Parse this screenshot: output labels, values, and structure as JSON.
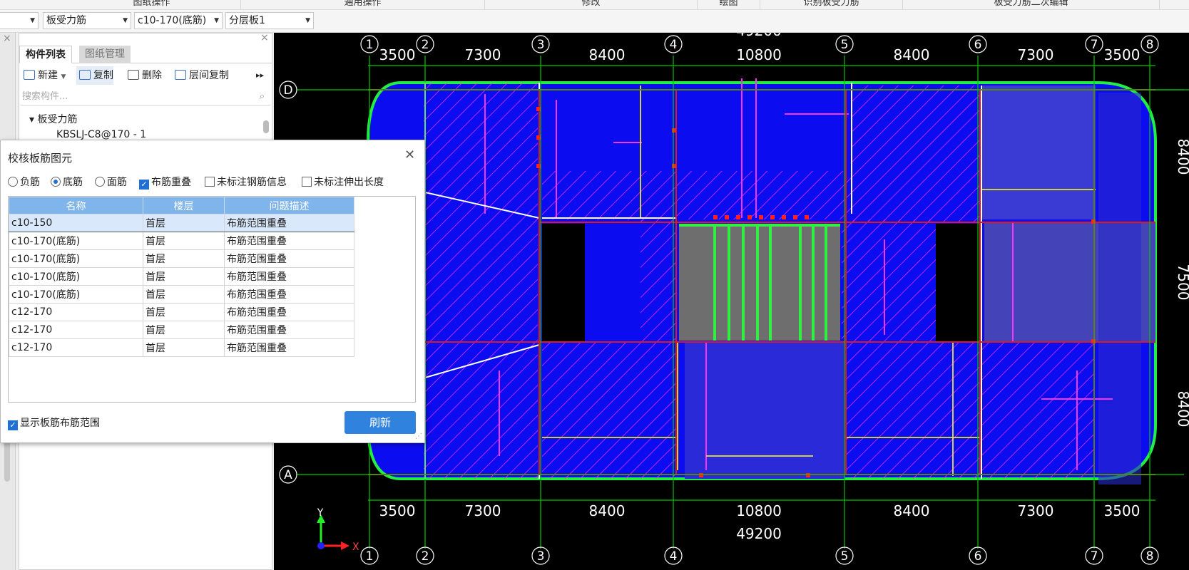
{
  "top_strip": {
    "cells": [
      "图纸操作",
      "通用操作",
      "修改",
      "绘图",
      "识别板受力筋",
      "板受力筋二次编辑"
    ]
  },
  "toolbar": {
    "dropdowns": [
      {
        "value": "",
        "arrow": "▼"
      },
      {
        "value": "板受力筋",
        "arrow": "▼"
      },
      {
        "value": "c10-170(底筋)",
        "arrow": "▼"
      },
      {
        "value": "分层板1",
        "arrow": "▼"
      }
    ]
  },
  "component_panel": {
    "close_glyph": "×",
    "tabs": [
      {
        "label": "构件列表"
      },
      {
        "label": "图纸管理"
      }
    ],
    "actions": {
      "new": "新建",
      "copy": "复制",
      "delete": "删除",
      "floor_copy": "层间复制",
      "more": "▸▸"
    },
    "search_placeholder": "搜索构件...",
    "tree_root": "▾ 板受力筋",
    "tree_item": "KBSLJ-C8@170 - 1"
  },
  "dialog": {
    "title": "校核板筋图元",
    "close_glyph": "✕",
    "options": {
      "neg": "负筋",
      "bottom": "底筋",
      "face": "面筋",
      "overlap": "布筋重叠",
      "unmarked_info": "未标注钢筋信息",
      "unmarked_len": "未标注伸出长度"
    },
    "columns": {
      "name": "名称",
      "floor": "楼层",
      "desc": "问题描述"
    },
    "rows": [
      {
        "name": "c10-150",
        "floor": "首层",
        "desc": "布筋范围重叠"
      },
      {
        "name": "c10-170(底筋)",
        "floor": "首层",
        "desc": "布筋范围重叠"
      },
      {
        "name": "c10-170(底筋)",
        "floor": "首层",
        "desc": "布筋范围重叠"
      },
      {
        "name": "c10-170(底筋)",
        "floor": "首层",
        "desc": "布筋范围重叠"
      },
      {
        "name": "c10-170(底筋)",
        "floor": "首层",
        "desc": "布筋范围重叠"
      },
      {
        "name": "c12-170",
        "floor": "首层",
        "desc": "布筋范围重叠"
      },
      {
        "name": "c12-170",
        "floor": "首层",
        "desc": "布筋范围重叠"
      },
      {
        "name": "c12-170",
        "floor": "首层",
        "desc": "布筋范围重叠"
      }
    ],
    "show_range": "显示板筋布筋范围",
    "refresh": "刷新"
  },
  "cad": {
    "axes_top": [
      "1",
      "2",
      "3",
      "4",
      "5",
      "6",
      "7",
      "8"
    ],
    "dims": [
      "3500",
      "7300",
      "8400",
      "10800",
      "8400",
      "7300",
      "3500"
    ],
    "total": "49200",
    "row_labels": [
      "D",
      "A"
    ],
    "right_dims": [
      "8400",
      "7500",
      "8400"
    ],
    "ucs_x": "X",
    "ucs_y": "Y",
    "colors": {
      "slab": "#0c0cf0",
      "hatch": "#ff33ff",
      "axis": "#00c800",
      "beam": "#e01818",
      "core": "#6e6e6e"
    }
  }
}
